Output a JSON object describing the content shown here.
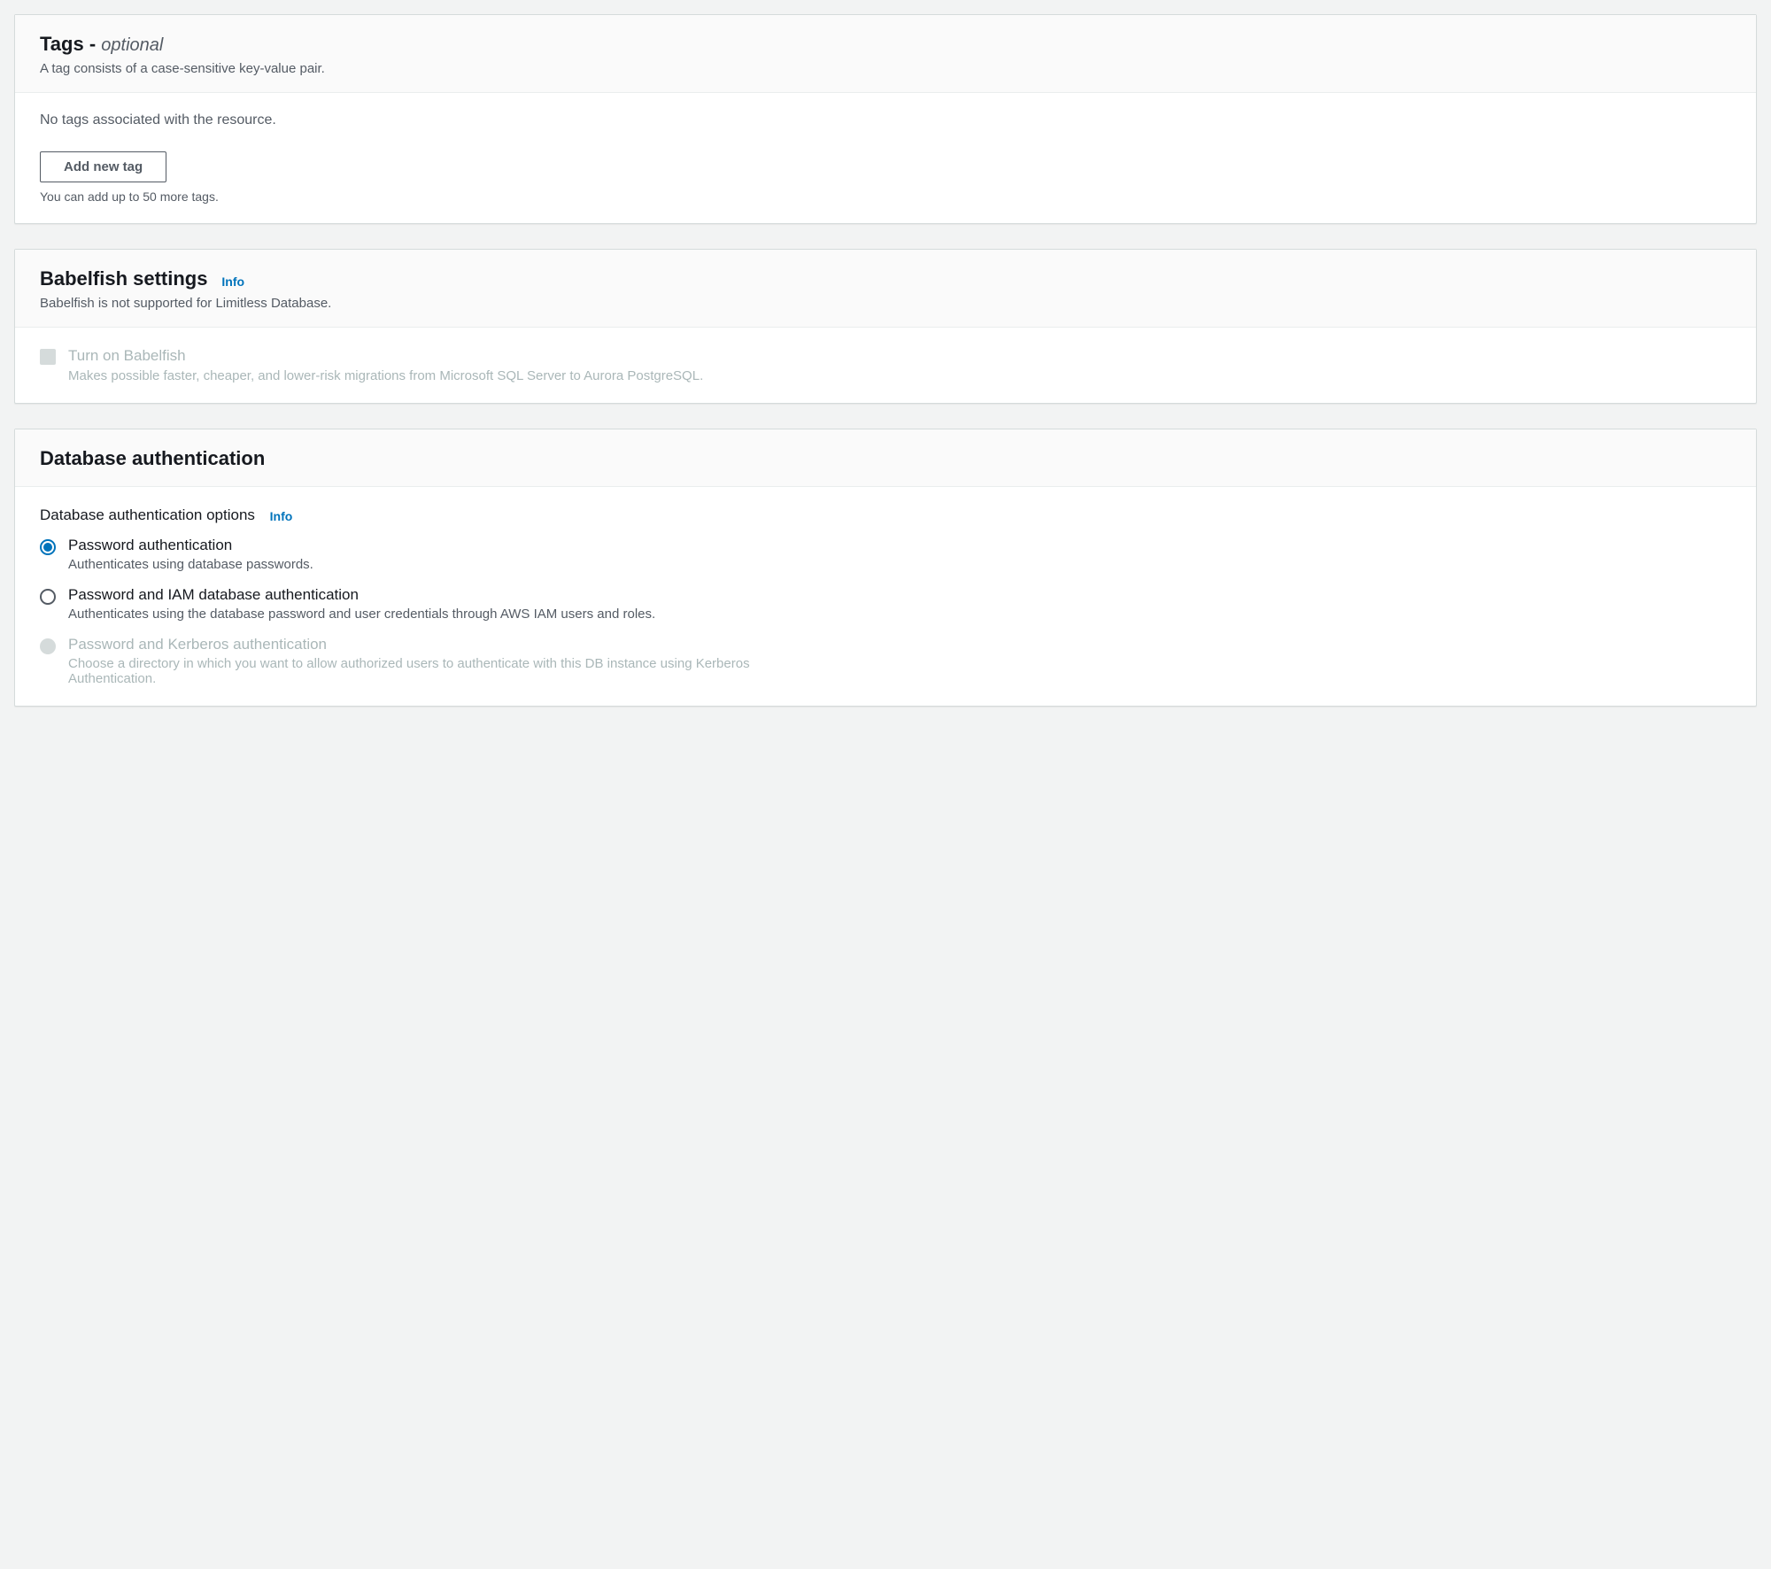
{
  "tags": {
    "title_main": "Tags - ",
    "title_optional": "optional",
    "desc": "A tag consists of a case-sensitive key-value pair.",
    "empty": "No tags associated with the resource.",
    "add_btn": "Add new tag",
    "hint": "You can add up to 50 more tags."
  },
  "babelfish": {
    "title": "Babelfish settings",
    "info": "Info",
    "desc": "Babelfish is not supported for Limitless Database.",
    "check_label": "Turn on Babelfish",
    "check_desc": "Makes possible faster, cheaper, and lower-risk migrations from Microsoft SQL Server to Aurora PostgreSQL."
  },
  "auth": {
    "title": "Database authentication",
    "subsection": "Database authentication options",
    "info": "Info",
    "options": [
      {
        "label": "Password authentication",
        "desc": "Authenticates using database passwords.",
        "selected": true,
        "disabled": false
      },
      {
        "label": "Password and IAM database authentication",
        "desc": "Authenticates using the database password and user credentials through AWS IAM users and roles.",
        "selected": false,
        "disabled": false
      },
      {
        "label": "Password and Kerberos authentication",
        "desc": "Choose a directory in which you want to allow authorized users to authenticate with this DB instance using Kerberos Authentication.",
        "selected": false,
        "disabled": true
      }
    ]
  }
}
